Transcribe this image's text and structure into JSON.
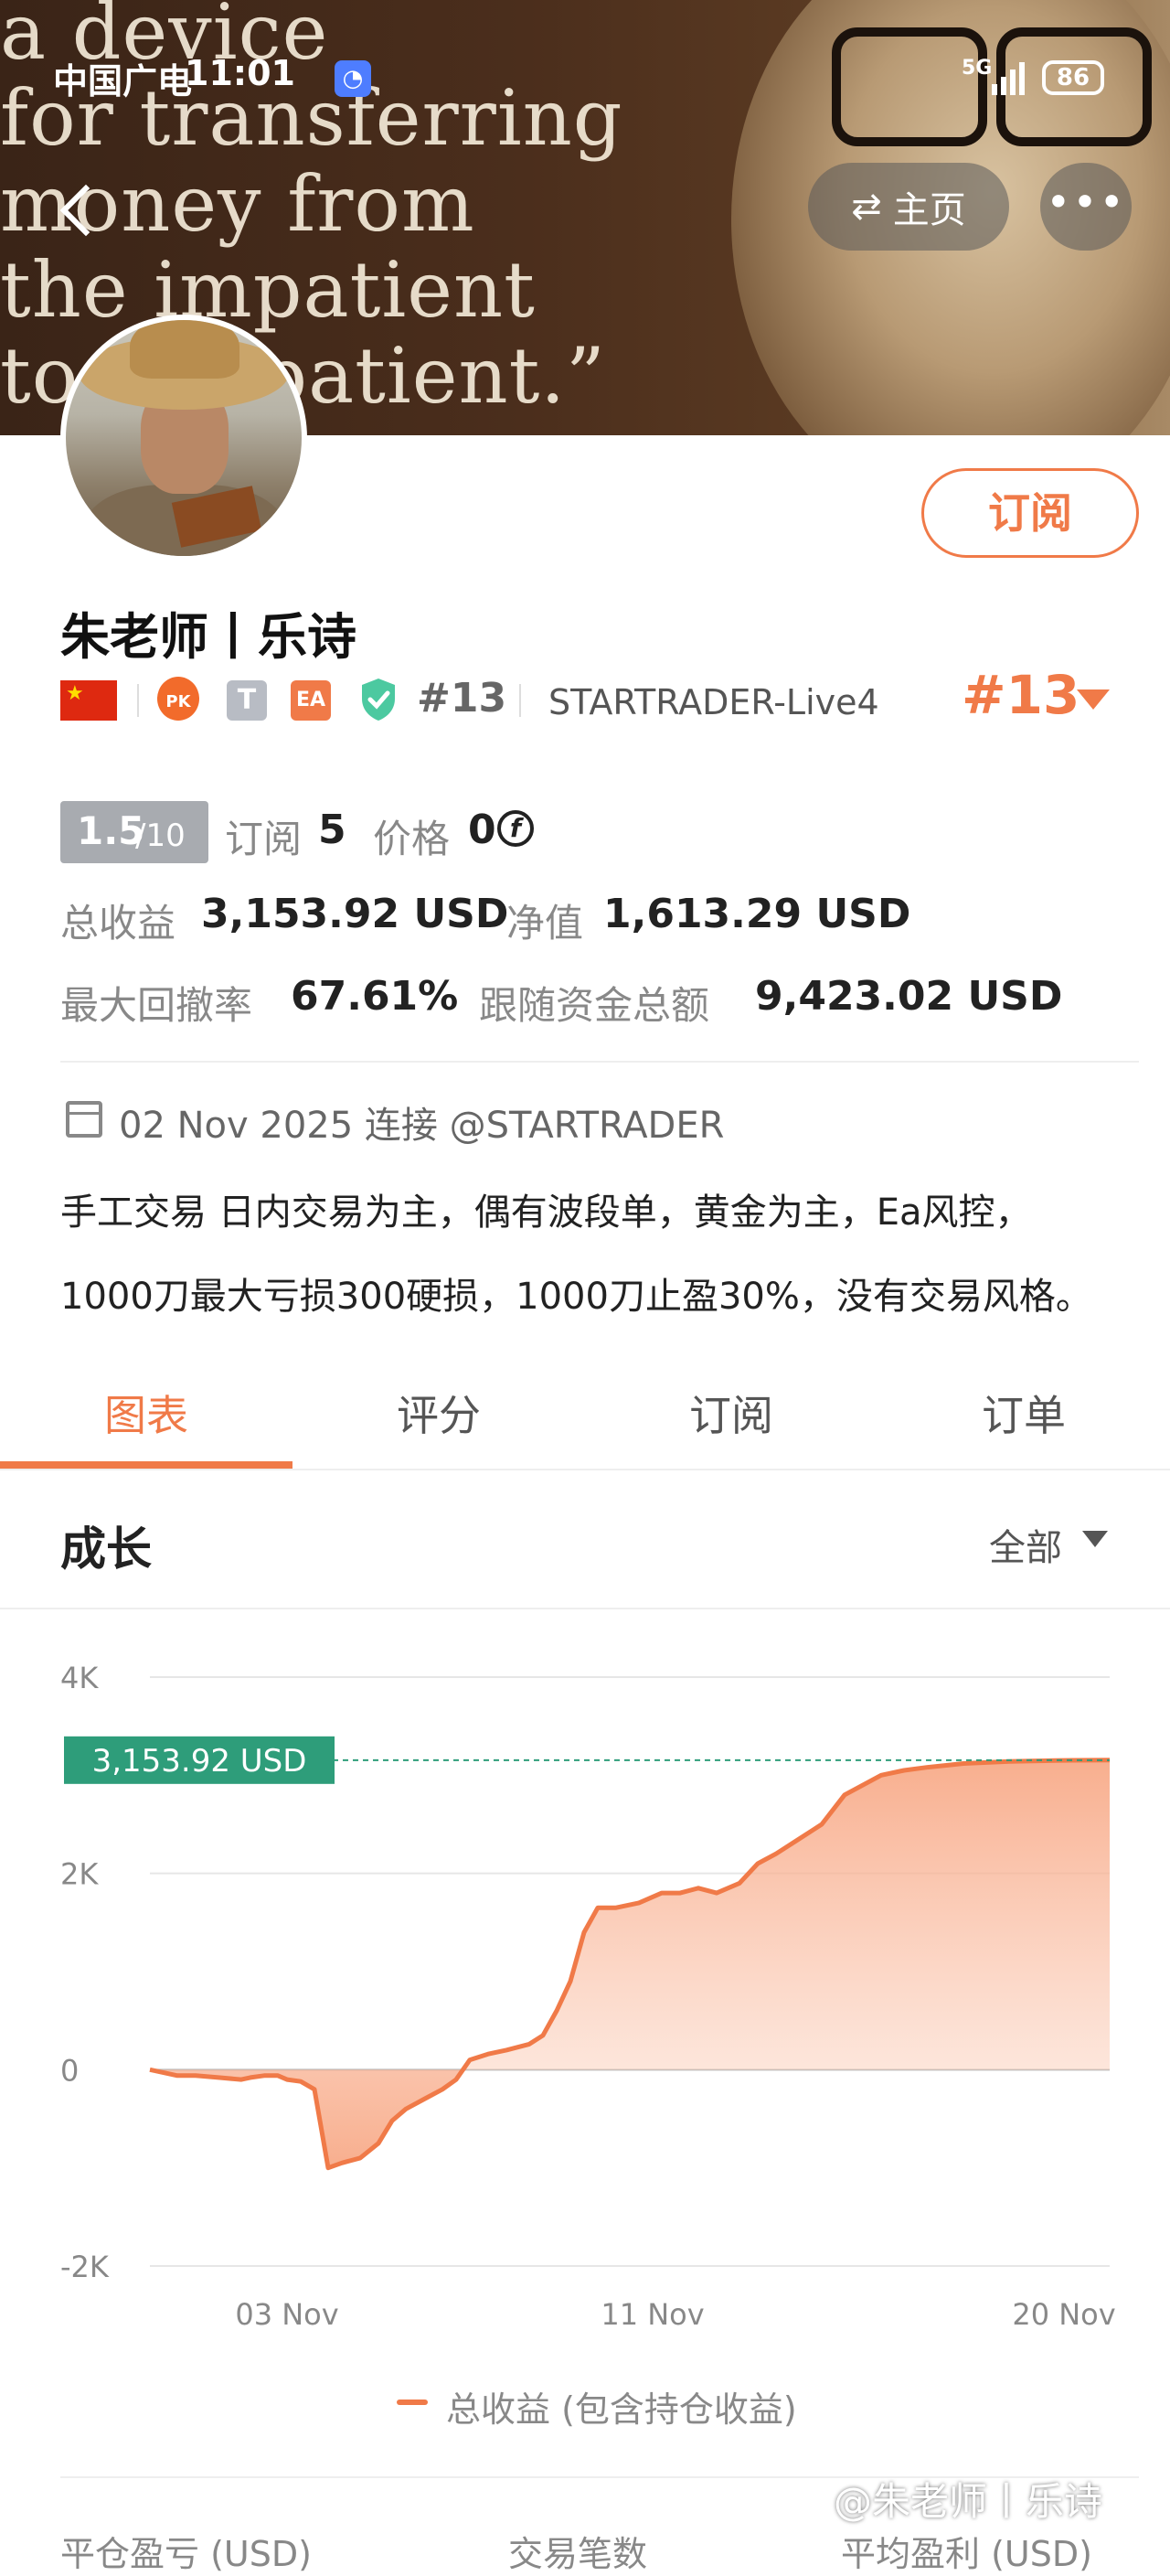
{
  "status_bar": {
    "carrier": "中国广电",
    "time": "11:01",
    "signal": "5G",
    "battery": "86"
  },
  "banner": {
    "quote": "a device\nfor transferring\nmoney from\nthe impatient\nto the patient.”",
    "home_label": "主页",
    "more_label": "•••"
  },
  "profile": {
    "subscribe_label": "订阅",
    "name": "朱老师丨乐诗",
    "pk_badge": "PK",
    "t_badge": "T",
    "ea_badge": "EA",
    "rank_small": "#13",
    "broker": "STARTRADER-Live4",
    "rank_big": "#13"
  },
  "stats": {
    "score_main": "1.5",
    "score_sub": "/10",
    "subscribe_label": "订阅",
    "subscribe_count": "5",
    "price_label": "价格",
    "price_value": "0",
    "coin_symbol": "f",
    "total_profit_label": "总收益",
    "total_profit_value": "3,153.92 USD",
    "equity_label": "净值",
    "equity_value": "1,613.29 USD",
    "max_drawdown_label": "最大回撤率",
    "max_drawdown_value": "67.61%",
    "follow_funds_label": "跟随资金总额",
    "follow_funds_value": "9,423.02 USD"
  },
  "connection": {
    "text": "02 Nov 2025 连接 @STARTRADER"
  },
  "description": "手工交易 日内交易为主，偶有波段单，黄金为主，Ea风控，1000刀最大亏损300硬损，1000刀止盈30%，没有交易风格。",
  "tabs": [
    {
      "label": "图表"
    },
    {
      "label": "评分"
    },
    {
      "label": "订阅"
    },
    {
      "label": "订单"
    }
  ],
  "growth": {
    "title": "成长",
    "filter": "全部"
  },
  "chart_data": {
    "type": "area",
    "title": "",
    "xlabel": "",
    "ylabel": "",
    "ylim": [
      -2000,
      4000
    ],
    "yticks": [
      "4K",
      "2K",
      "0",
      "-2K"
    ],
    "yticks_values": [
      4000,
      2000,
      0,
      -2000
    ],
    "xticks": [
      "03 Nov",
      "11 Nov",
      "20 Nov"
    ],
    "xticks_values": [
      3,
      11,
      20
    ],
    "current_value_label": "3,153.92 USD",
    "current_value": 3153.92,
    "series": [
      {
        "name": "总收益 (包含持仓收益)",
        "color": "#f07a48",
        "x": [
          0,
          0.6,
          1,
          1.5,
          2,
          2.2,
          2.5,
          2.8,
          3.0,
          3.3,
          3.6,
          3.9,
          4.2,
          4.6,
          5.0,
          5.3,
          5.6,
          6.0,
          6.4,
          6.7,
          7.0,
          7.4,
          7.8,
          8.3,
          8.6,
          8.9,
          9.2,
          9.5,
          9.8,
          10.2,
          10.7,
          11.2,
          11.6,
          12.0,
          12.4,
          12.9,
          13.3,
          13.7,
          14.2,
          14.7,
          15.2,
          15.6,
          16.0,
          16.5,
          17.0,
          17.4,
          17.8,
          18.3,
          18.8,
          19.3,
          19.8,
          20.2,
          20.6,
          21.0
        ],
        "y": [
          0,
          -60,
          -60,
          -80,
          -100,
          -80,
          -60,
          -60,
          -100,
          -120,
          -200,
          -1000,
          -950,
          -900,
          -750,
          -520,
          -400,
          -300,
          -200,
          -100,
          100,
          160,
          200,
          260,
          350,
          600,
          900,
          1400,
          1650,
          1650,
          1700,
          1800,
          1800,
          1850,
          1800,
          1900,
          2100,
          2200,
          2350,
          2500,
          2800,
          2900,
          3000,
          3050,
          3080,
          3100,
          3120,
          3130,
          3140,
          3145,
          3150,
          3152,
          3153,
          3153.92
        ]
      }
    ],
    "grid": true,
    "legend": "bottom-center"
  },
  "bottom_stats": {
    "closed_pl_label": "平仓盈亏 (USD)",
    "trade_count_label": "交易笔数",
    "avg_profit_label": "平均盈利 (USD)"
  },
  "watermark": "@朱老师丨乐诗"
}
